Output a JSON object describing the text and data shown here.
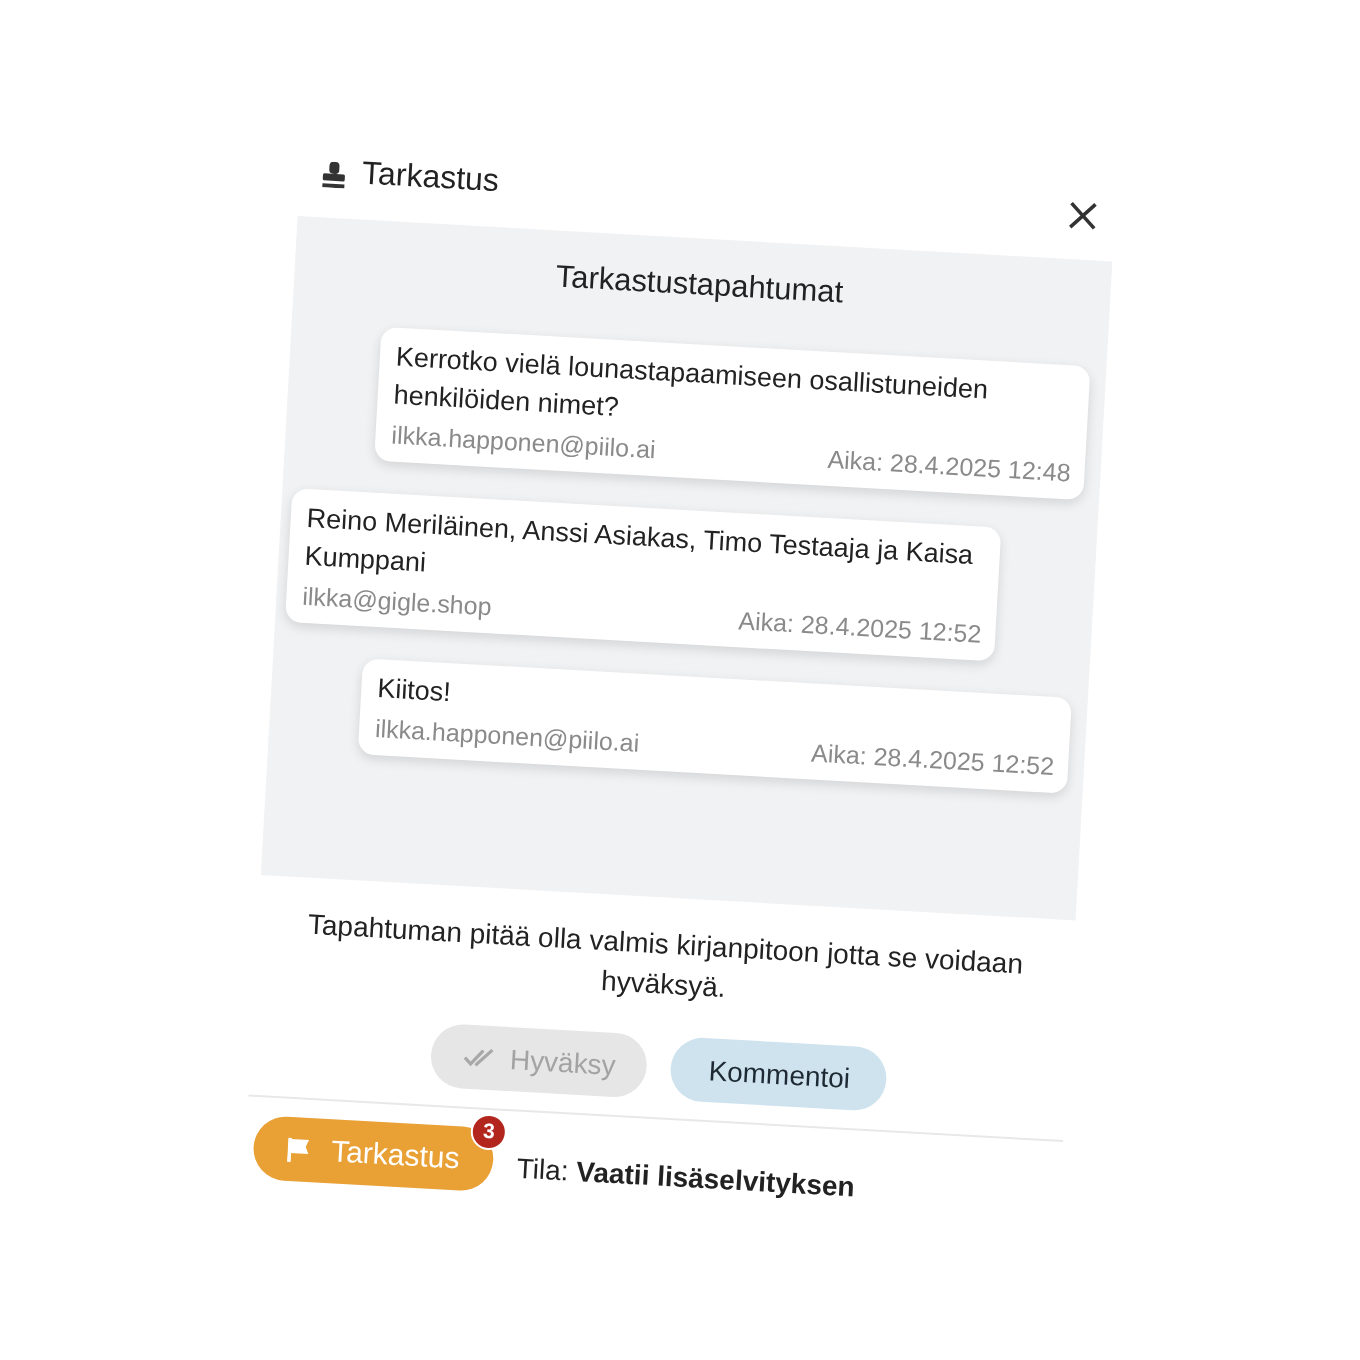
{
  "dialog": {
    "title": "Tarkastus"
  },
  "panel": {
    "title": "Tarkastustapahtumat",
    "messages": [
      {
        "text": "Kerrotko vielä lounastapaamiseen osallistuneiden henkilöiden nimet?",
        "sender": "ilkka.happonen@piilo.ai",
        "time": "Aika: 28.4.2025 12:48",
        "own": true
      },
      {
        "text": "Reino Meriläinen, Anssi Asiakas, Timo Testaaja ja Kaisa Kumppani",
        "sender": "ilkka@gigle.shop",
        "time": "Aika: 28.4.2025 12:52",
        "own": false
      },
      {
        "text": "Kiitos!",
        "sender": "ilkka.happonen@piilo.ai",
        "time": "Aika: 28.4.2025 12:52",
        "own": true
      }
    ]
  },
  "notice": "Tapahtuman pitää olla valmis kirjanpitoon jotta se voidaan hyväksyä.",
  "actions": [
    {
      "label": "Hyväksy",
      "kind": "approve",
      "disabled": true
    },
    {
      "label": "Kommentoi",
      "kind": "comment",
      "disabled": false
    }
  ],
  "footer": {
    "button": {
      "label": "Tarkastus",
      "badge": "3"
    },
    "status": "Tila: **Vaatii lisäselvityksen**"
  }
}
